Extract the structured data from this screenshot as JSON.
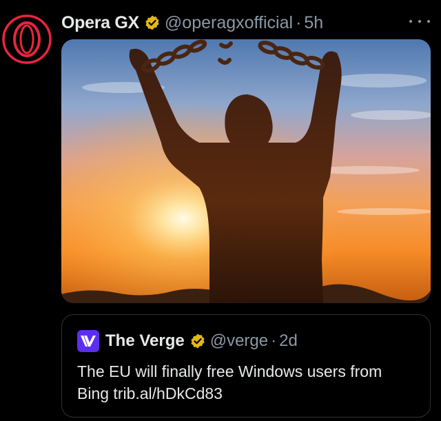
{
  "post": {
    "author_name": "Opera GX",
    "handle": "@operagxofficial",
    "separator": "·",
    "time": "5h",
    "avatar_icon": "opera-gx-logo-icon",
    "verified_icon": "gold-verified-badge-icon",
    "more_icon": "more-options-icon",
    "media_description_icon": "photo-silhouette-breaking-chains-sunset"
  },
  "quoted": {
    "author_name": "The Verge",
    "handle": "@verge",
    "separator": "·",
    "time": "2d",
    "avatar_icon": "the-verge-logo-icon",
    "verified_icon": "gold-verified-badge-icon",
    "text": "The EU will finally free Windows users from Bing trib.al/hDkCd83"
  },
  "colors": {
    "background": "#000000",
    "opera_red": "#e8253d",
    "verge_purple": "#5c2ff0",
    "verified_gold": "#e2b719",
    "secondary_text": "#8b98a5",
    "border": "#2f3336"
  }
}
